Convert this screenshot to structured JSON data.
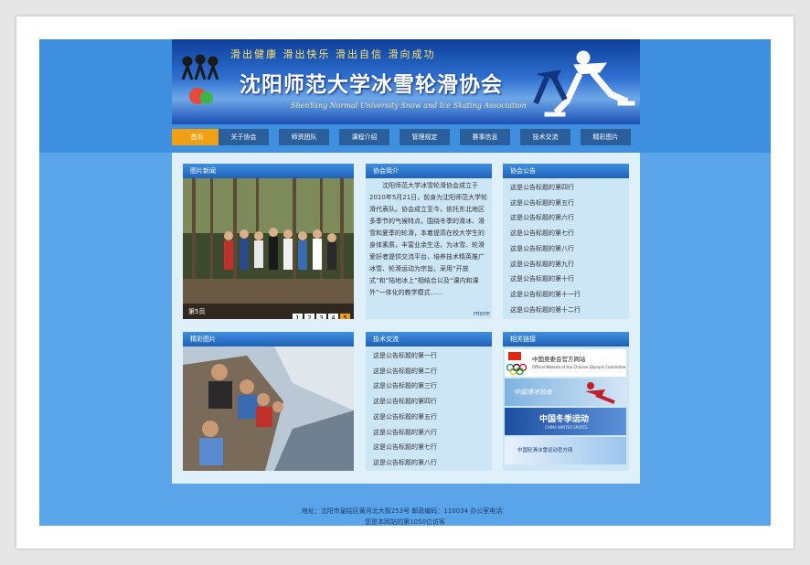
{
  "header": {
    "slogan": "滑出健康   滑出快乐   滑出自信   滑向成功",
    "title": "沈阳师范大学冰雪轮滑协会",
    "subtitle": "ShenYang Normal University Snow and Ice Skating Association"
  },
  "nav": {
    "items": [
      {
        "label": "首页"
      },
      {
        "label": "关于协会"
      },
      {
        "label": "师资团队"
      },
      {
        "label": "课程介绍"
      },
      {
        "label": "管理规定"
      },
      {
        "label": "赛事信息"
      },
      {
        "label": "技术交流"
      },
      {
        "label": "精彩图片"
      }
    ]
  },
  "photo_news": {
    "title": "图片新闻",
    "caption": "第5页",
    "pages": [
      "1",
      "2",
      "3",
      "4",
      "5"
    ]
  },
  "intro": {
    "title": "协会简介",
    "text": "沈阳师范大学冰雪轮滑协会成立于2010年5月21日，前身为沈阳师范大学轮滑代表队。协会成立至今，依托东北地区多季节的气候特点，围绕冬季的滑冰、滑雪和夏季的轮滑，本着提高在校大学生的身体素质，丰富业余生活，为冰雪、轮滑爱好者提供交流平台，培养技术精英推广冰雪、轮滑运动为宗旨。采用“开放式”和“陆地冰上”相结合以及“课内和课外”一体化的教学模式……",
    "more": "more"
  },
  "notices": {
    "title": "协会公告",
    "items": [
      "这是公告标题的第四行",
      "这是公告标题的第五行",
      "这是公告标题的第六行",
      "这是公告标题的第七行",
      "这是公告标题的第八行",
      "这是公告标题的第九行",
      "这是公告标题的第十行",
      "这是公告标题的第十一行",
      "这是公告标题的第十二行"
    ]
  },
  "gallery": {
    "title": "精彩图片"
  },
  "tech": {
    "title": "技术交流",
    "items": [
      "这是公告标题的第一行",
      "这是公告标题的第二行",
      "这是公告标题的第三行",
      "这是公告标题的第四行",
      "这是公告标题的第五行",
      "这是公告标题的第六行",
      "这是公告标题的第七行",
      "这是公告标题的第八行"
    ]
  },
  "links": {
    "title": "相关链接",
    "items": [
      {
        "label": "中国奥委会官方网站",
        "sub": "Official Website of the Chinese Olympic Committee"
      },
      {
        "label": "中国滑冰协会"
      },
      {
        "label": "中国冬季运动",
        "sub": "CHINA WINTER SPORTS"
      },
      {
        "label": "中国轮滑冰雪运动官方网"
      }
    ]
  },
  "footer": {
    "address": "地址：沈阳市皇姑区黄河北大街253号  邮政编码：110034  办公室电话：",
    "visits": "您是本网站的第1050位访客"
  },
  "colors": {
    "page_bg": "#5aa5ea",
    "nav_active": "#f0a010",
    "nav_item": "#2a5f9c",
    "panel_header": "#1f62b8"
  }
}
